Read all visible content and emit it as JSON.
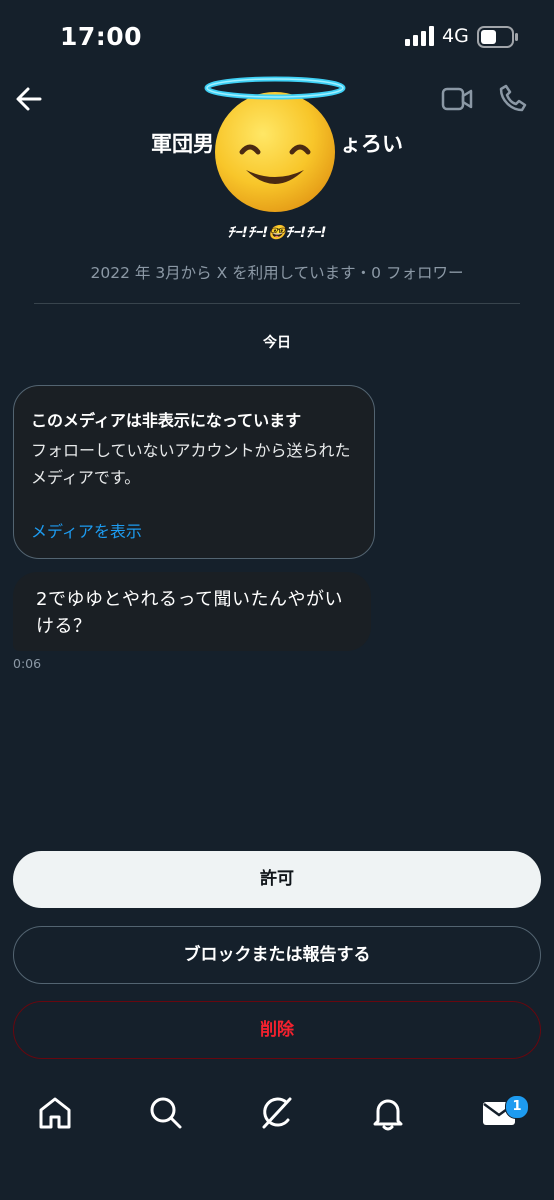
{
  "status_bar": {
    "time": "17:00",
    "network": "4G",
    "battery_level": 0.5
  },
  "header": {
    "title": "軍団男　　　　　　ょろい",
    "bio": "ﾁｰ!ﾁｰ!🤓ﾁｰ!ﾁｰ!",
    "meta": "2022 年 3月から X を利用しています・0 フォロワー",
    "icons": {
      "back": "back-arrow-icon",
      "video": "video-call-icon",
      "phone": "phone-call-icon"
    }
  },
  "avatar": {
    "icon": "smiling-face-with-halo-emoji"
  },
  "conversation": {
    "date_label": "今日",
    "media_card": {
      "title": "このメディアは非表示になっています",
      "description": "フォローしていないアカウントから送られたメディアです。",
      "link": "メディアを表示"
    },
    "message": {
      "text": "2でゆゆとやれるって聞いたんやがいける？",
      "time": "0:06"
    }
  },
  "actions": {
    "allow": "許可",
    "block_report": "ブロックまたは報告する",
    "delete": "削除"
  },
  "bottom_nav": {
    "items": [
      "home-icon",
      "search-icon",
      "grok-icon",
      "notifications-icon",
      "messages-icon"
    ],
    "messages_badge": "1"
  },
  "colors": {
    "background": "#15202b",
    "accent": "#1d9bf0",
    "danger": "#f4212e",
    "muted_text": "#8b98a5"
  }
}
